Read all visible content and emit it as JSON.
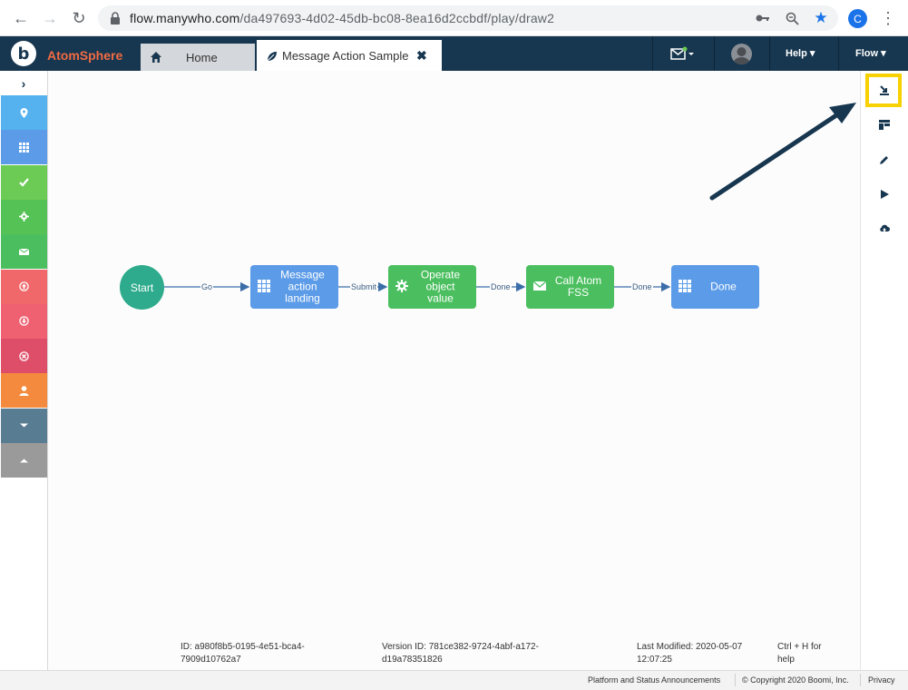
{
  "browser": {
    "url_host": "flow.manywho.com",
    "url_path": "/da497693-4d02-45db-bc08-8ea16d2ccbdf/play/draw2",
    "profile_initial": "C"
  },
  "header": {
    "brand": "AtomSphere",
    "logo_letter": "b",
    "home_tab": "Home",
    "active_tab": "Message Action Sample",
    "help_label": "Help",
    "flow_label": "Flow",
    "colors": {
      "bar": "#17364f",
      "brand": "#f26b43"
    }
  },
  "sidebar": {
    "items": [
      {
        "name": "location",
        "icon": "map-pin-icon",
        "color": "#55b2ee"
      },
      {
        "name": "page",
        "icon": "grid-icon",
        "color": "#5b9be8"
      },
      {
        "name": "decision",
        "icon": "check-icon",
        "color": "#6ccb55"
      },
      {
        "name": "operator",
        "icon": "gear-icon",
        "color": "#55c255"
      },
      {
        "name": "message",
        "icon": "envelope-icon",
        "color": "#4bbf5f"
      },
      {
        "name": "database-save",
        "icon": "upload-icon",
        "color": "#f0686a"
      },
      {
        "name": "database-load",
        "icon": "download-icon",
        "color": "#ef6070"
      },
      {
        "name": "database-delete",
        "icon": "delete-icon",
        "color": "#df4e69"
      },
      {
        "name": "swimlane",
        "icon": "user-icon",
        "color": "#f38a3e"
      },
      {
        "name": "more",
        "icon": "chevron-down-icon",
        "color": "#587d92"
      },
      {
        "name": "less",
        "icon": "chevron-up-icon",
        "color": "#9a9a9a"
      }
    ]
  },
  "flow": {
    "start_label": "Start",
    "nodes": [
      {
        "label": "Message action landing",
        "icon": "grid-icon",
        "color": "#5b9be8"
      },
      {
        "label": "Operate object value",
        "icon": "gear-icon",
        "color": "#4bbf5f"
      },
      {
        "label": "Call Atom FSS",
        "icon": "envelope-icon",
        "color": "#4bbf5f"
      },
      {
        "label": "Done",
        "icon": "grid-icon",
        "color": "#5b9be8"
      }
    ],
    "edges": [
      "Go",
      "Submit",
      "Done",
      "Done"
    ]
  },
  "info": {
    "id_text": "ID: a980f8b5-0195-4e51-bca4-7909d10762a7",
    "version_text": "Version ID: 781ce382-9724-4abf-a172-d19a78351826",
    "modified_text": "Last Modified: 2020-05-07 12:07:25",
    "shortcut_text": "Ctrl + H for help"
  },
  "status_bar": {
    "announcements": "Platform and Status Announcements",
    "copyright": "© Copyright 2020 Boomi, Inc.",
    "privacy": "Privacy"
  },
  "highlight_color": "#f7d100",
  "arrow_color": "#17364f"
}
